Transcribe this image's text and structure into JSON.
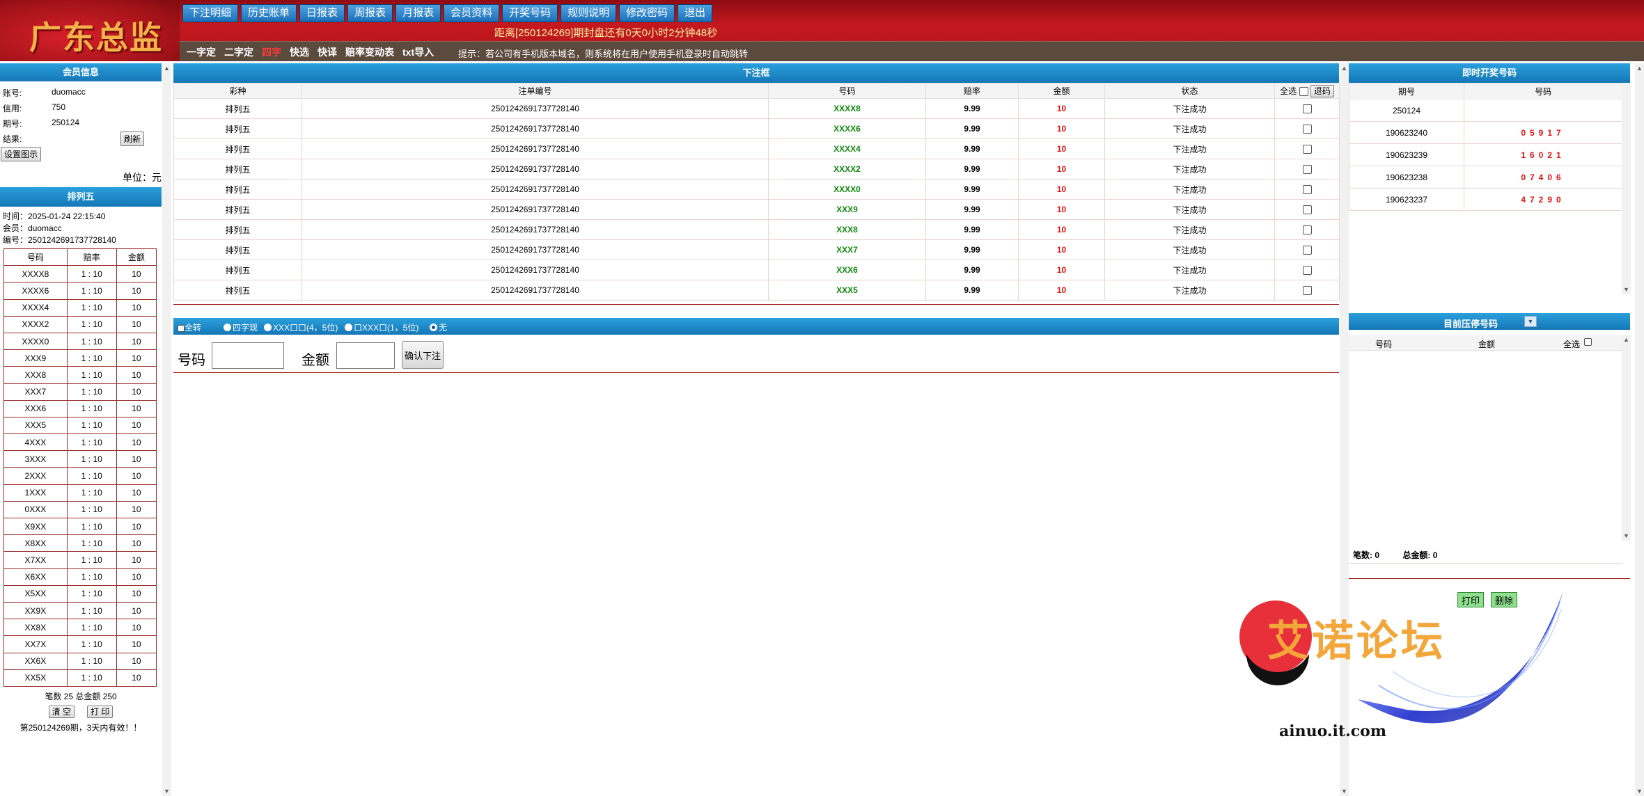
{
  "header": {
    "logo": "广东总监",
    "nav": [
      "下注明细",
      "历史账单",
      "日报表",
      "周报表",
      "月报表",
      "会员资料",
      "开奖号码",
      "规则说明",
      "修改密码",
      "退出"
    ],
    "countdown": "距离[250124269]期封盘还有0天0小时2分钟48秒",
    "subnav": [
      {
        "label": "一字定",
        "active": false
      },
      {
        "label": "二字定",
        "active": false
      },
      {
        "label": "四字",
        "active": true
      },
      {
        "label": "快选",
        "active": false
      },
      {
        "label": "快译",
        "active": false
      },
      {
        "label": "赔率变动表",
        "active": false
      },
      {
        "label": "txt导入",
        "active": false
      }
    ],
    "tip": "提示：若公司有手机版本域名，则系统将在用户使用手机登录时自动跳转"
  },
  "member": {
    "title": "会员信息",
    "account_label": "账号:",
    "account": "duomacc",
    "credit_label": "信用:",
    "credit": "750",
    "period_label": "期号:",
    "period": "250124",
    "result_label": "结果:",
    "refresh": "刷新",
    "settings": "设置图示",
    "unit": "单位：元"
  },
  "ticket": {
    "title": "排列五",
    "time": "时间：2025-01-24 22:15:40",
    "member": "会员：duomacc",
    "serial": "编号：2501242691737728140",
    "headers": [
      "号码",
      "赔率",
      "金额"
    ],
    "rows": [
      [
        "XXXX8",
        "1 : 10",
        "10"
      ],
      [
        "XXXX6",
        "1 : 10",
        "10"
      ],
      [
        "XXXX4",
        "1 : 10",
        "10"
      ],
      [
        "XXXX2",
        "1 : 10",
        "10"
      ],
      [
        "XXXX0",
        "1 : 10",
        "10"
      ],
      [
        "XXX9",
        "1 : 10",
        "10"
      ],
      [
        "XXX8",
        "1 : 10",
        "10"
      ],
      [
        "XXX7",
        "1 : 10",
        "10"
      ],
      [
        "XXX6",
        "1 : 10",
        "10"
      ],
      [
        "XXX5",
        "1 : 10",
        "10"
      ],
      [
        "4XXX",
        "1 : 10",
        "10"
      ],
      [
        "3XXX",
        "1 : 10",
        "10"
      ],
      [
        "2XXX",
        "1 : 10",
        "10"
      ],
      [
        "1XXX",
        "1 : 10",
        "10"
      ],
      [
        "0XXX",
        "1 : 10",
        "10"
      ],
      [
        "X9XX",
        "1 : 10",
        "10"
      ],
      [
        "X8XX",
        "1 : 10",
        "10"
      ],
      [
        "X7XX",
        "1 : 10",
        "10"
      ],
      [
        "X6XX",
        "1 : 10",
        "10"
      ],
      [
        "X5XX",
        "1 : 10",
        "10"
      ],
      [
        "XX9X",
        "1 : 10",
        "10"
      ],
      [
        "XX8X",
        "1 : 10",
        "10"
      ],
      [
        "XX7X",
        "1 : 10",
        "10"
      ],
      [
        "XX6X",
        "1 : 10",
        "10"
      ],
      [
        "XX5X",
        "1 : 10",
        "10"
      ]
    ],
    "summary": "笔数 25 总金额 250",
    "clear": "清 空",
    "print": "打 印",
    "validity": "第250124269期，3天内有效！！"
  },
  "bets": {
    "title": "下注框",
    "headers": [
      "彩种",
      "注单编号",
      "号码",
      "赔率",
      "金额",
      "状态",
      "全选"
    ],
    "refund": "退码",
    "rows": [
      [
        "排列五",
        "2501242691737728140",
        "XXXX8",
        "9.99",
        "10",
        "下注成功"
      ],
      [
        "排列五",
        "2501242691737728140",
        "XXXX6",
        "9.99",
        "10",
        "下注成功"
      ],
      [
        "排列五",
        "2501242691737728140",
        "XXXX4",
        "9.99",
        "10",
        "下注成功"
      ],
      [
        "排列五",
        "2501242691737728140",
        "XXXX2",
        "9.99",
        "10",
        "下注成功"
      ],
      [
        "排列五",
        "2501242691737728140",
        "XXXX0",
        "9.99",
        "10",
        "下注成功"
      ],
      [
        "排列五",
        "2501242691737728140",
        "XXX9",
        "9.99",
        "10",
        "下注成功"
      ],
      [
        "排列五",
        "2501242691737728140",
        "XXX8",
        "9.99",
        "10",
        "下注成功"
      ],
      [
        "排列五",
        "2501242691737728140",
        "XXX7",
        "9.99",
        "10",
        "下注成功"
      ],
      [
        "排列五",
        "2501242691737728140",
        "XXX6",
        "9.99",
        "10",
        "下注成功"
      ],
      [
        "排列五",
        "2501242691737728140",
        "XXX5",
        "9.99",
        "10",
        "下注成功"
      ]
    ]
  },
  "options": {
    "all_turn": "全转",
    "radios": [
      {
        "label": "四字现",
        "selected": false
      },
      {
        "label": "XXX口口(4，5位)",
        "selected": false
      },
      {
        "label": "口XXX口(1，5位)",
        "selected": false
      },
      {
        "label": "无",
        "selected": true
      }
    ]
  },
  "entry": {
    "number_label": "号码",
    "amount_label": "金额",
    "number_value": "",
    "amount_value": "",
    "confirm": "确认下注"
  },
  "draws": {
    "title": "即时开奖号码",
    "headers": [
      "期号",
      "号码"
    ],
    "rows": [
      [
        "250124",
        ""
      ],
      [
        "190623240",
        "05917"
      ],
      [
        "190623239",
        "16021"
      ],
      [
        "190623238",
        "07406"
      ],
      [
        "190623237",
        "47290"
      ]
    ]
  },
  "hold": {
    "title": "目前压停号码",
    "headers": [
      "号码",
      "金额",
      "全选"
    ],
    "count": "笔数:  0",
    "total": "总金额:  0",
    "print": "打印",
    "delete": "删除"
  },
  "watermark": {
    "title": "艾诺论坛",
    "url": "ainuo.it.com"
  },
  "colors": {
    "header_red": "#c4181f",
    "nav_blue": "#1b6fb8",
    "section_blue": "#1576b6",
    "number_green": "#118a11",
    "amount_red": "#e01010",
    "subbar_brown": "#5b4a3e"
  }
}
